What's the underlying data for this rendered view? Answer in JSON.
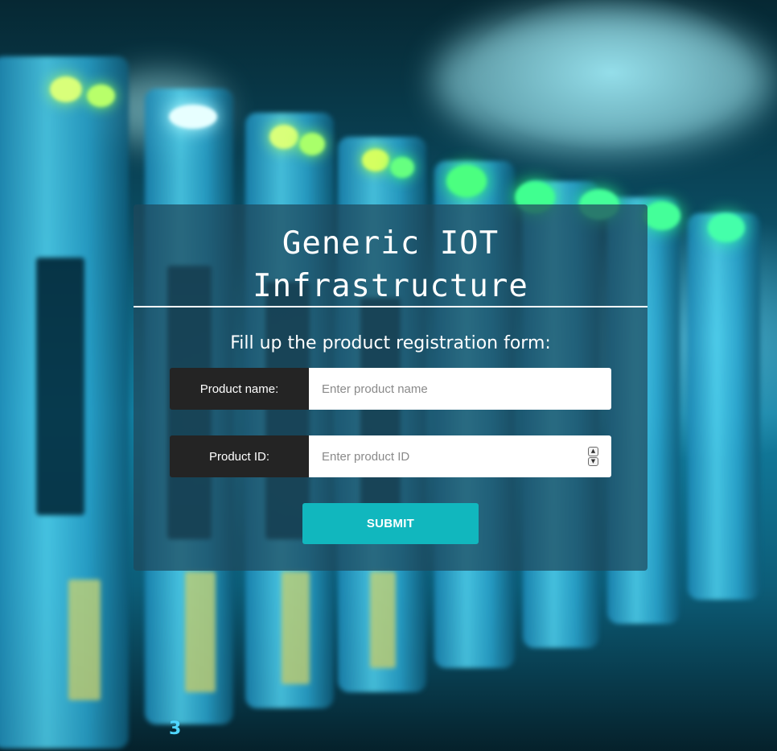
{
  "form": {
    "title_line1": "Generic IOT",
    "title_line2": "Infrastructure",
    "subtitle": "Fill up the product registration form:",
    "product_name": {
      "label": "Product name:",
      "placeholder": "Enter product name",
      "value": ""
    },
    "product_id": {
      "label": "Product ID:",
      "placeholder": "Enter product ID",
      "value": "",
      "spinner_up_icon": "chevron-up-icon",
      "spinner_down_icon": "chevron-down-icon"
    },
    "submit_label": "SUBMIT"
  },
  "background": {
    "rack_number": "3"
  },
  "colors": {
    "card_bg": "#1e485c",
    "label_bg": "#242424",
    "submit_bg": "#11b7be",
    "text": "#ffffff"
  }
}
